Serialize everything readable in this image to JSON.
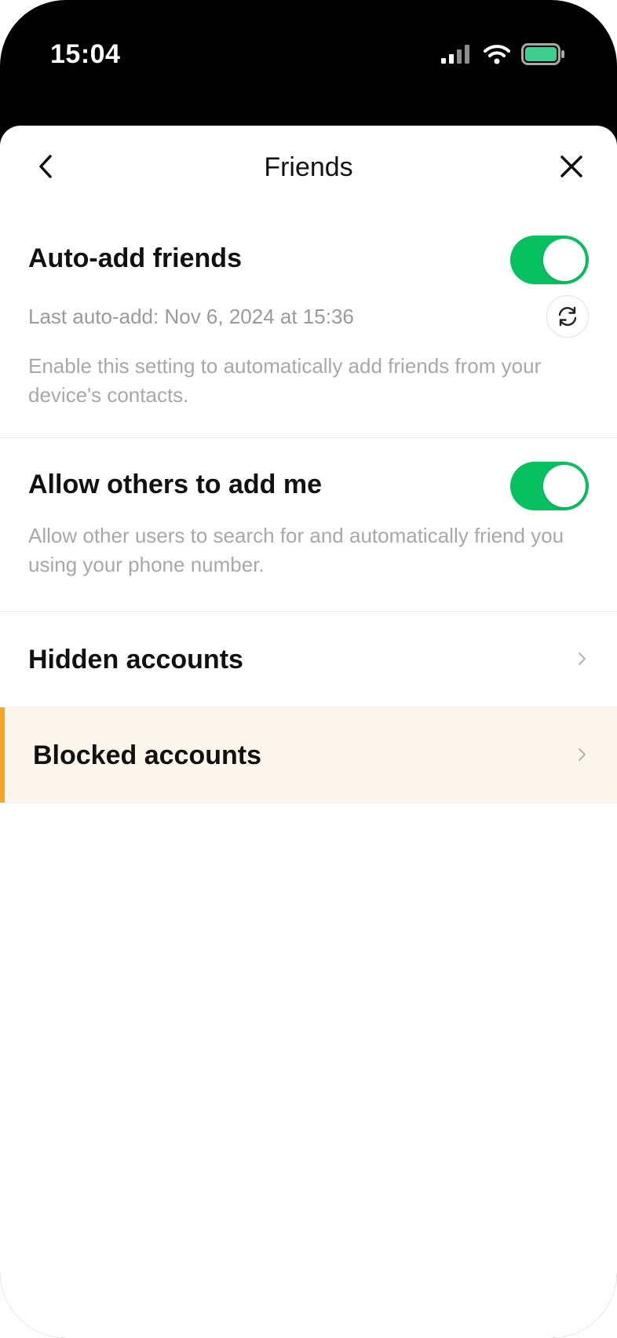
{
  "status_bar": {
    "time": "15:04",
    "icons": [
      "signal-icon",
      "wifi-icon",
      "battery-icon"
    ],
    "battery_color": "#3ecf8e"
  },
  "header": {
    "title": "Friends",
    "back_icon": "chevron-left-icon",
    "close_icon": "close-icon"
  },
  "auto_add": {
    "title": "Auto-add friends",
    "enabled": true,
    "last_auto_add": "Last auto-add: Nov 6, 2024 at 15:36",
    "refresh_icon": "refresh-icon",
    "description": "Enable this setting to automatically add friends from your device's contacts."
  },
  "allow_others": {
    "title": "Allow others to add me",
    "enabled": true,
    "description": "Allow other users to search for and automatically friend you using your phone number."
  },
  "nav_rows": [
    {
      "label": "Hidden accounts",
      "icon": "chevron-right-icon"
    },
    {
      "label": "Blocked accounts",
      "icon": "chevron-right-icon",
      "highlighted": true
    }
  ],
  "colors": {
    "toggle_on": "#07c160",
    "highlight_bg": "#fdf6ec",
    "highlight_accent": "#f5a623"
  }
}
